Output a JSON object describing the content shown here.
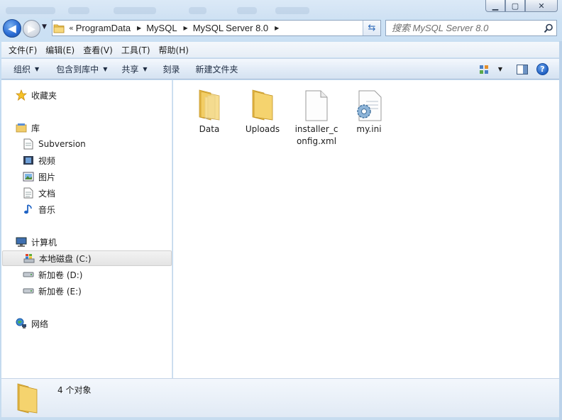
{
  "window": {
    "minimize_glyph": "▁",
    "maximize_glyph": "▢",
    "close_glyph": "✕"
  },
  "address": {
    "overflow": "«",
    "crumbs": [
      "ProgramData",
      "MySQL",
      "MySQL Server 8.0"
    ],
    "search_placeholder": "搜索 MySQL Server 8.0"
  },
  "menu": [
    "文件(F)",
    "编辑(E)",
    "查看(V)",
    "工具(T)",
    "帮助(H)"
  ],
  "commands": {
    "organize": "组织",
    "include_in_library": "包含到库中",
    "share": "共享",
    "burn": "刻录",
    "new_folder": "新建文件夹",
    "help_glyph": "?"
  },
  "nav": {
    "favorites": "收藏夹",
    "libraries": "库",
    "library_items": [
      "Subversion",
      "视频",
      "图片",
      "文档",
      "音乐"
    ],
    "computer": "计算机",
    "drives": [
      "本地磁盘 (C:)",
      "新加卷 (D:)",
      "新加卷 (E:)"
    ],
    "network": "网络",
    "selected": "本地磁盘 (C:)"
  },
  "files": [
    {
      "name": "Data",
      "icon": "folder-icon"
    },
    {
      "name": "Uploads",
      "icon": "folder-icon"
    },
    {
      "name": "installer_config.xml",
      "icon": "xml-file-icon"
    },
    {
      "name": "my.ini",
      "icon": "ini-settings-file-icon"
    }
  ],
  "status": {
    "count": "4 个对象"
  },
  "colors": {
    "folder": "#f3cf6b",
    "selection": "#e4e4e4",
    "chrome": "#cfe3f5"
  }
}
